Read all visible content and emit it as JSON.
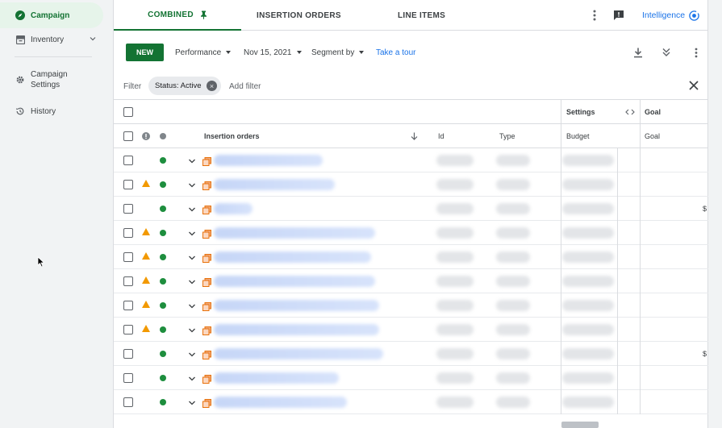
{
  "sidebar": {
    "items": [
      {
        "label": "Campaign",
        "icon": "compass-icon",
        "active": true
      },
      {
        "label": "Inventory",
        "icon": "inventory-icon"
      },
      {
        "label": "Campaign Settings",
        "icon": "gear-icon"
      },
      {
        "label": "History",
        "icon": "history-icon"
      }
    ]
  },
  "tabs": [
    {
      "label": "COMBINED",
      "active": true,
      "pinned": true
    },
    {
      "label": "INSERTION ORDERS"
    },
    {
      "label": "LINE ITEMS"
    }
  ],
  "header_right": {
    "intelligence_label": "Intelligence"
  },
  "toolbar": {
    "new_label": "NEW",
    "performance_label": "Performance",
    "date_label": "Nov 15, 2021",
    "segment_label": "Segment by",
    "tour_label": "Take a tour"
  },
  "filter": {
    "label": "Filter",
    "chip_label": "Status: Active",
    "add_label": "Add filter"
  },
  "table": {
    "group_headers": {
      "settings": "Settings",
      "goal": "Goal"
    },
    "columns": {
      "name": "Insertion orders",
      "id": "Id",
      "type": "Type",
      "budget": "Budget",
      "goal": "Goal"
    },
    "rows": [
      {
        "warning": false,
        "dollar": false
      },
      {
        "warning": true,
        "dollar": false
      },
      {
        "warning": false,
        "dollar": true
      },
      {
        "warning": true,
        "dollar": false
      },
      {
        "warning": true,
        "dollar": false
      },
      {
        "warning": true,
        "dollar": false
      },
      {
        "warning": true,
        "dollar": false
      },
      {
        "warning": true,
        "dollar": false
      },
      {
        "warning": false,
        "dollar": true
      },
      {
        "warning": false,
        "dollar": false
      },
      {
        "warning": false,
        "dollar": false
      }
    ],
    "dollar_symbol": "$"
  },
  "colors": {
    "accent": "#137333",
    "status_active": "#1e8e3e",
    "warning": "#f29900",
    "link": "#1a73e8"
  }
}
